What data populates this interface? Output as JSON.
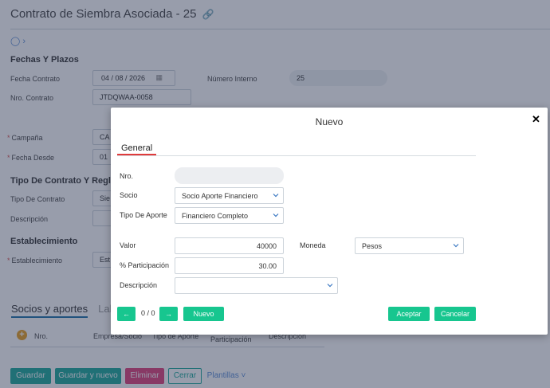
{
  "page": {
    "title": "Contrato de Siembra Asociada - 25",
    "section_fechas": "Fechas Y Plazos",
    "fecha_contrato_label": "Fecha Contrato",
    "fecha_contrato_value": "04 / 08 / 2026",
    "numero_interno_label": "Número Interno",
    "numero_interno_value": "25",
    "nro_contrato_label": "Nro. Contrato",
    "nro_contrato_value": "JTDQWAA-0058",
    "campana_label": "Campaña",
    "campana_value": "CA",
    "fecha_desde_label": "Fecha Desde",
    "fecha_desde_value": "01",
    "section_tipo": "Tipo De Contrato Y Reglas I",
    "tipo_contrato_label": "Tipo De Contrato",
    "tipo_contrato_value": "Sie",
    "descripcion_label": "Descripción",
    "section_establecimiento": "Establecimiento",
    "establecimiento_label": "Establecimiento",
    "establecimiento_value": "Est",
    "tab_socios": "Socios y aportes",
    "tab_labores": "Labo",
    "grid_cols": [
      "Nro.",
      "Empresa/Socio",
      "Tipo de Aporte",
      "Participación",
      "Descripción"
    ],
    "btn_guardar": "Guardar",
    "btn_guardar_nuevo": "Guardar y nuevo",
    "btn_eliminar": "Eliminar",
    "btn_cerrar": "Cerrar",
    "btn_plantillas": "Plantillas"
  },
  "modal": {
    "title": "Nuevo",
    "tab_general": "General",
    "nro_label": "Nro.",
    "nro_value": "",
    "socio_label": "Socio",
    "socio_value": "Socio Aporte Financiero",
    "tipo_aporte_label": "Tipo De Aporte",
    "tipo_aporte_value": "Financiero Completo",
    "valor_label": "Valor",
    "valor_value": "40000",
    "moneda_label": "Moneda",
    "moneda_value": "Pesos",
    "participacion_label": "% Participación",
    "participacion_value": "30.00",
    "descripcion_label": "Descripción",
    "descripcion_value": "",
    "pager": "0 / 0",
    "btn_nuevo": "Nuevo",
    "btn_aceptar": "Aceptar",
    "btn_cancelar": "Cancelar"
  },
  "colors": {
    "accent_green": "#17c68f",
    "teal": "#1aa99a",
    "danger": "#e0407a",
    "tab_underline": "#e03b3b"
  }
}
